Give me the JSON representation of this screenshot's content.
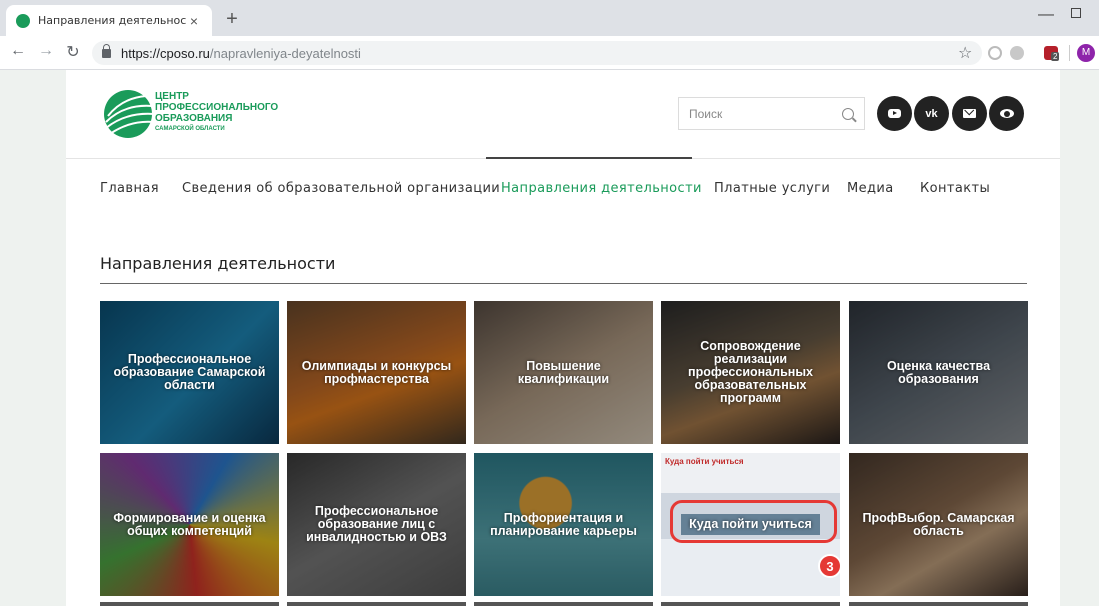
{
  "browser": {
    "tab_title": "Направления деятельности",
    "tab_close": "×",
    "new_tab": "+",
    "url_host": "https://cposo.ru",
    "url_path": "/napravleniya-deyatelnosti",
    "ext_badge": "2",
    "avatar_letter": "M"
  },
  "header": {
    "logo_lines": [
      "ЦЕНТР",
      "ПРОФЕССИОНАЛЬНОГО",
      "ОБРАЗОВАНИЯ"
    ],
    "logo_sub": "САМАРСКОЙ ОБЛАСТИ",
    "search_placeholder": "Поиск",
    "social": [
      "youtube-icon",
      "vk-icon",
      "mail-icon",
      "eye-icon"
    ],
    "vk_label": "vk"
  },
  "nav": {
    "items": [
      "Главная",
      "Сведения об образовательной организации",
      "Направления деятельности",
      "Платные услуги",
      "Медиа",
      "Контакты"
    ],
    "active_index": 2
  },
  "section": {
    "title": "Направления деятельности"
  },
  "cards": [
    "Профессиональное образование Самарской области",
    "Олимпиады и конкурсы профмастерства",
    "Повышение квалификации",
    "Сопровождение реализации профессиональных образовательных программ",
    "Оценка качества образования",
    "Формирование и оценка общих компетенций",
    "Профессиональное образование лиц с инвалидностью и ОВЗ",
    "Профориентация и планирование карьеры",
    "Куда пойти учиться",
    "ПрофВыбор. Самарская область"
  ],
  "card9_header": "Куда пойти учиться",
  "annotation": {
    "number": "3",
    "color": "#e53935"
  },
  "colors": {
    "accent": "#1a9b5a"
  }
}
